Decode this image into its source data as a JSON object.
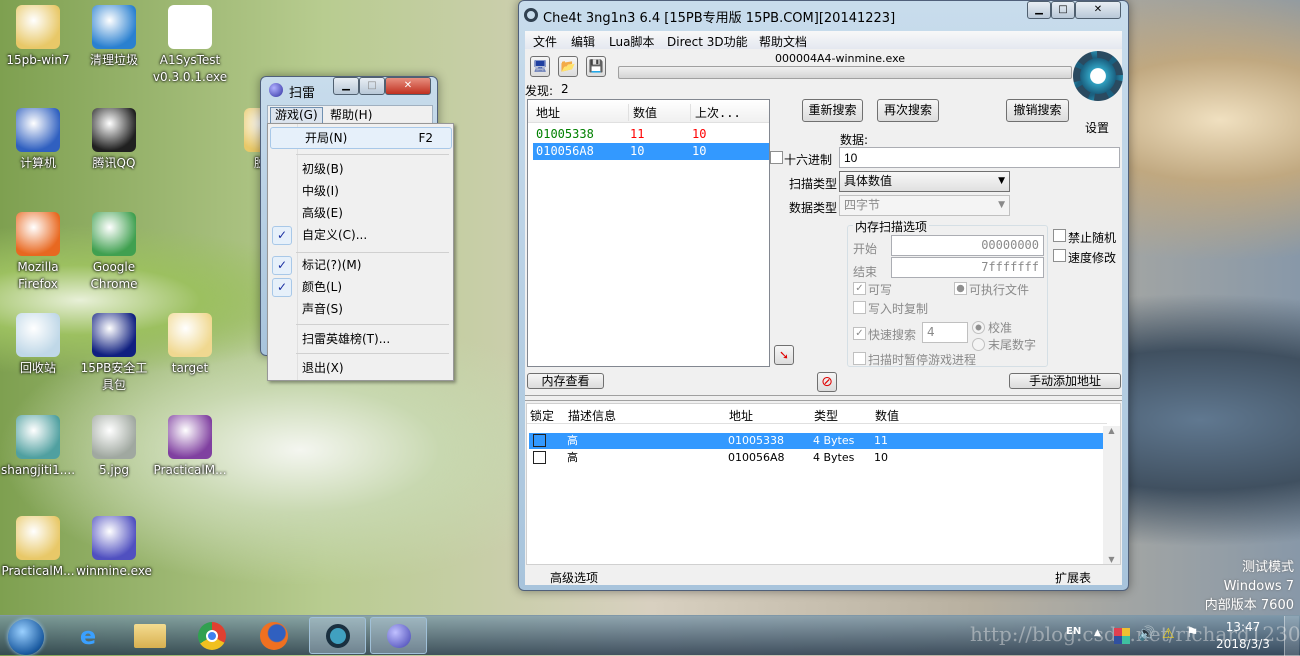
{
  "desktop": {
    "icons": [
      {
        "label": "15pb-win7",
        "icon": "user-folder-icon",
        "color": "#e8c868"
      },
      {
        "label": "清理垃圾",
        "icon": "broom-icon",
        "color": "#2a80d0"
      },
      {
        "label": "A1SysTest v0.3.0.1.exe",
        "icon": "a1-systest-icon",
        "color": "#ffffff"
      },
      {
        "label": "计算机",
        "icon": "computer-icon",
        "color": "#3060c0"
      },
      {
        "label": "腾讯QQ",
        "icon": "qq-penguin-icon",
        "color": "#202020"
      },
      {
        "label": "脱壳",
        "icon": "folder-icon",
        "color": "#e8c868"
      },
      {
        "label": "Mozilla Firefox",
        "icon": "firefox-icon",
        "color": "#e86820"
      },
      {
        "label": "Google Chrome",
        "icon": "chrome-icon",
        "color": "#40a050"
      },
      {
        "label": "回收站",
        "icon": "recycle-bin-icon",
        "color": "#c0d8e8"
      },
      {
        "label": "15PB安全工具包",
        "icon": "15pb-icon",
        "color": "#102080"
      },
      {
        "label": "target",
        "icon": "folder-icon",
        "color": "#f0d890"
      },
      {
        "label": "shangjiti1....",
        "icon": "window-file-icon",
        "color": "#50a0a0"
      },
      {
        "label": "5.jpg",
        "icon": "image-icon",
        "color": "#a0a8a0"
      },
      {
        "label": "PracticalM...",
        "icon": "winrar-icon",
        "color": "#8040a0"
      },
      {
        "label": "PracticalM...",
        "icon": "folder-icon",
        "color": "#e8c868"
      },
      {
        "label": "winmine.exe",
        "icon": "mine-icon",
        "color": "#5050c0"
      }
    ],
    "watermark": {
      "line1": "测试模式",
      "line2": "Windows 7",
      "line3": "内部版本 7600"
    },
    "url_watermark": "http://blog.csdn.net/richard1230"
  },
  "minesweeper": {
    "title": "扫雷",
    "menu": [
      "游戏(G)",
      "帮助(H)"
    ],
    "dropdown": [
      {
        "label": "开局(N)",
        "shortcut": "F2",
        "checked": false,
        "highlighted": true
      },
      {
        "label": "初级(B)",
        "checked": false
      },
      {
        "label": "中级(I)",
        "checked": false
      },
      {
        "label": "高级(E)",
        "checked": false
      },
      {
        "label": "自定义(C)...",
        "checked": true
      },
      {
        "label": "标记(?)(M)",
        "checked": true
      },
      {
        "label": "颜色(L)",
        "checked": true
      },
      {
        "label": "声音(S)",
        "checked": false
      },
      {
        "label": "扫雷英雄榜(T)...",
        "checked": false
      },
      {
        "label": "退出(X)",
        "checked": false
      }
    ],
    "check_glyph": "✓"
  },
  "ce": {
    "title": "Che4t 3ng1n3 6.4 [15PB专用版 15PB.COM][20141223]",
    "menu": [
      "文件",
      "编辑",
      "Lua脚本",
      "Direct 3D功能",
      "帮助文档"
    ],
    "process": "000004A4-winmine.exe",
    "progress": 0,
    "found_label": "发现:",
    "found_count": "2",
    "results": {
      "headers": [
        "地址",
        "数值",
        "上次..."
      ],
      "rows": [
        {
          "address": "01005338",
          "value": "11",
          "previous": "10",
          "selected": false
        },
        {
          "address": "010056A8",
          "value": "10",
          "previous": "10",
          "selected": true
        }
      ]
    },
    "buttons": {
      "new_scan": "重新搜索",
      "next_scan": "再次搜索",
      "undo_scan": "撤销搜索",
      "settings": "设置",
      "memory_view": "内存查看",
      "add_address": "手动添加地址"
    },
    "logo_text": "Cheat Engine",
    "value_label": "数据:",
    "hex_label": "十六进制",
    "value": "10",
    "scan_type_label": "扫描类型",
    "scan_type": "具体数值",
    "value_type_label": "数据类型",
    "value_type": "四字节",
    "memory_options": {
      "title": "内存扫描选项",
      "start_label": "开始",
      "start": "00000000",
      "stop_label": "结束",
      "stop": "7fffffff",
      "writable": "可写",
      "writable_checked": true,
      "executable": "可执行文件",
      "copy_on_write": "写入时复制",
      "fast_scan": "快速搜索",
      "fast_scan_checked": true,
      "fast_scan_value": "4",
      "alignment": "校准",
      "last_digits": "末尾数字",
      "pause": "扫描时暂停游戏进程"
    },
    "disable_random": "禁止随机",
    "speedhack": "速度修改",
    "address_list": {
      "headers": [
        "锁定",
        "描述信息",
        "地址",
        "类型",
        "数值"
      ],
      "rows": [
        {
          "desc": "高",
          "address": "01005338",
          "type": "4 Bytes",
          "value": "11",
          "selected": true
        },
        {
          "desc": "高",
          "address": "010056A8",
          "type": "4 Bytes",
          "value": "10",
          "selected": false
        }
      ]
    },
    "footer_left": "高级选项",
    "footer_right": "扩展表",
    "colors": {
      "changed_address": "#008000",
      "changed_value": "#ff0000",
      "selection": "#3399ff"
    }
  },
  "taskbar": {
    "lang": "EN",
    "time": "13:47",
    "date": "2018/3/3"
  }
}
